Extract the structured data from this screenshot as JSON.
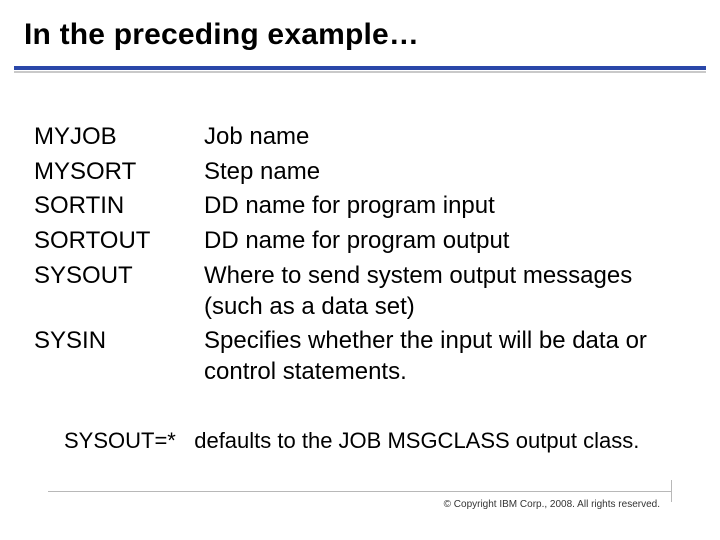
{
  "title": "In the preceding example…",
  "definitions": [
    {
      "term": "MYJOB",
      "desc": "Job name"
    },
    {
      "term": "MYSORT",
      "desc": "Step name"
    },
    {
      "term": "SORTIN",
      "desc": "DD name for program input"
    },
    {
      "term": "SORTOUT",
      "desc": "DD name for program output"
    },
    {
      "term": "SYSOUT",
      "desc": "Where to send system output messages (such as a data set)"
    },
    {
      "term": "SYSIN",
      "desc": "Specifies whether the input will be data or control statements."
    }
  ],
  "note_left": "SYSOUT=*",
  "note_right": "defaults to the JOB MSGCLASS output class.",
  "copyright": "© Copyright IBM Corp., 2008. All rights reserved."
}
